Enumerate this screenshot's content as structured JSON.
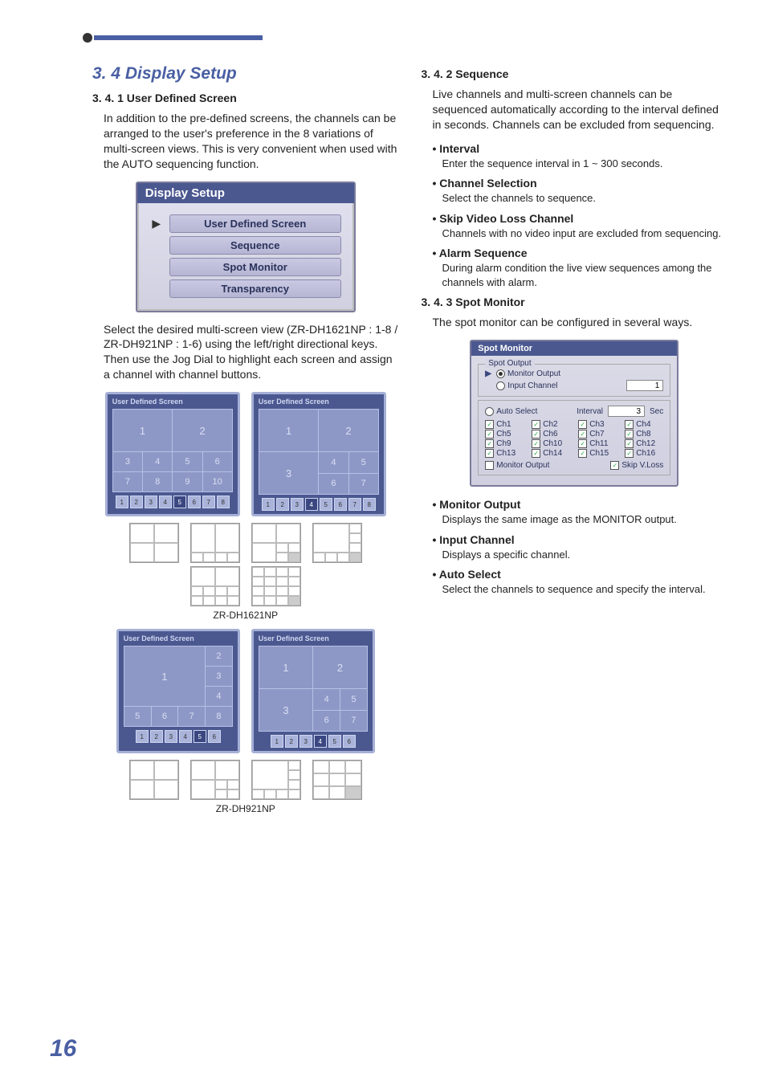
{
  "page_number": "16",
  "left": {
    "section_title": "3. 4 Display Setup",
    "sub_341": "3. 4. 1 User Defined Screen",
    "p1": "In addition to the pre-defined screens, the channels can be arranged to the user's preference in the 8 variations of multi-screen views. This is very convenient when used with the AUTO sequencing function.",
    "menu_title": "Display Setup",
    "menu_items": [
      "User Defined Screen",
      "Sequence",
      "Spot Monitor",
      "Transparency"
    ],
    "p2": "Select the desired multi-screen view (ZR-DH1621NP : 1-8 / ZR-DH921NP : 1-6) using the left/right directional keys. Then use the Jog Dial to highlight each screen and assign a channel with channel buttons.",
    "uds_head": "User Defined Screen",
    "caption1": "ZR-DH1621NP",
    "caption2": "ZR-DH921NP"
  },
  "right": {
    "sub_342": "3. 4. 2 Sequence",
    "p_seq": "Live channels and multi-screen channels can be sequenced automatically according to the interval defined in seconds. Channels can be excluded from sequencing.",
    "interval_h": "Interval",
    "interval_b": "Enter the sequence interval in 1 ~ 300 seconds.",
    "chsel_h": "Channel Selection",
    "chsel_b": "Select the channels to sequence.",
    "skip_h": "Skip Video Loss Channel",
    "skip_b": "Channels with no video input are excluded from sequencing.",
    "alarm_h": "Alarm Sequence",
    "alarm_b": "During alarm condition the live view sequences among the channels with alarm.",
    "sub_343": "3. 4. 3 Spot Monitor",
    "p_spot": "The spot monitor can be configured in several ways.",
    "spot": {
      "title": "Spot Monitor",
      "group_label": "Spot Output",
      "monitor_output": "Monitor Output",
      "input_channel": "Input Channel",
      "auto_select": "Auto Select",
      "interval_label": "Interval",
      "interval_value": "3",
      "interval_unit": "Sec",
      "input_value": "1",
      "channels": [
        "Ch1",
        "Ch2",
        "Ch3",
        "Ch4",
        "Ch5",
        "Ch6",
        "Ch7",
        "Ch8",
        "Ch9",
        "Ch10",
        "Ch11",
        "Ch12",
        "Ch13",
        "Ch14",
        "Ch15",
        "Ch16"
      ],
      "mon_out_chk": "Monitor Output",
      "skip_vloss": "Skip V.Loss"
    },
    "mo_h": "Monitor Output",
    "mo_b": "Displays the same image as the MONITOR output.",
    "ic_h": "Input Channel",
    "ic_b": "Displays a specific channel.",
    "as_h": "Auto Select",
    "as_b": "Select the channels to sequence and specify the interval."
  }
}
